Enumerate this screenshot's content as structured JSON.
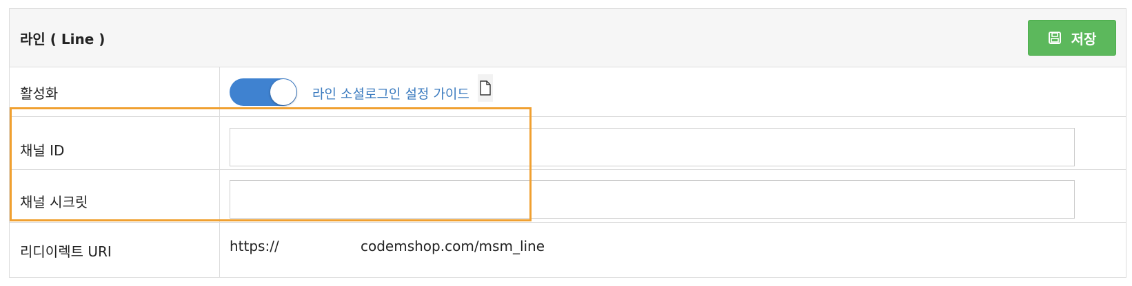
{
  "header": {
    "title": "라인 ( Line )",
    "save_label": "저장",
    "save_icon": "floppy-disk-icon",
    "save_color": "#5cb85c"
  },
  "rows": {
    "activate": {
      "label": "활성화",
      "toggle_on": true,
      "toggle_color": "#3f82d0",
      "guide_link": "라인 소셜로그인 설정 가이드",
      "guide_icon": "document-icon"
    },
    "channel_id": {
      "label": "채널 ID",
      "value": "",
      "placeholder": ""
    },
    "channel_secret": {
      "label": "채널 시크릿",
      "value": "",
      "placeholder": ""
    },
    "redirect_uri": {
      "label": "리디이렉트 URI",
      "prefix": "https://",
      "suffix": "codemshop.com/msm_line"
    }
  },
  "highlight": {
    "color": "#f0a030"
  }
}
